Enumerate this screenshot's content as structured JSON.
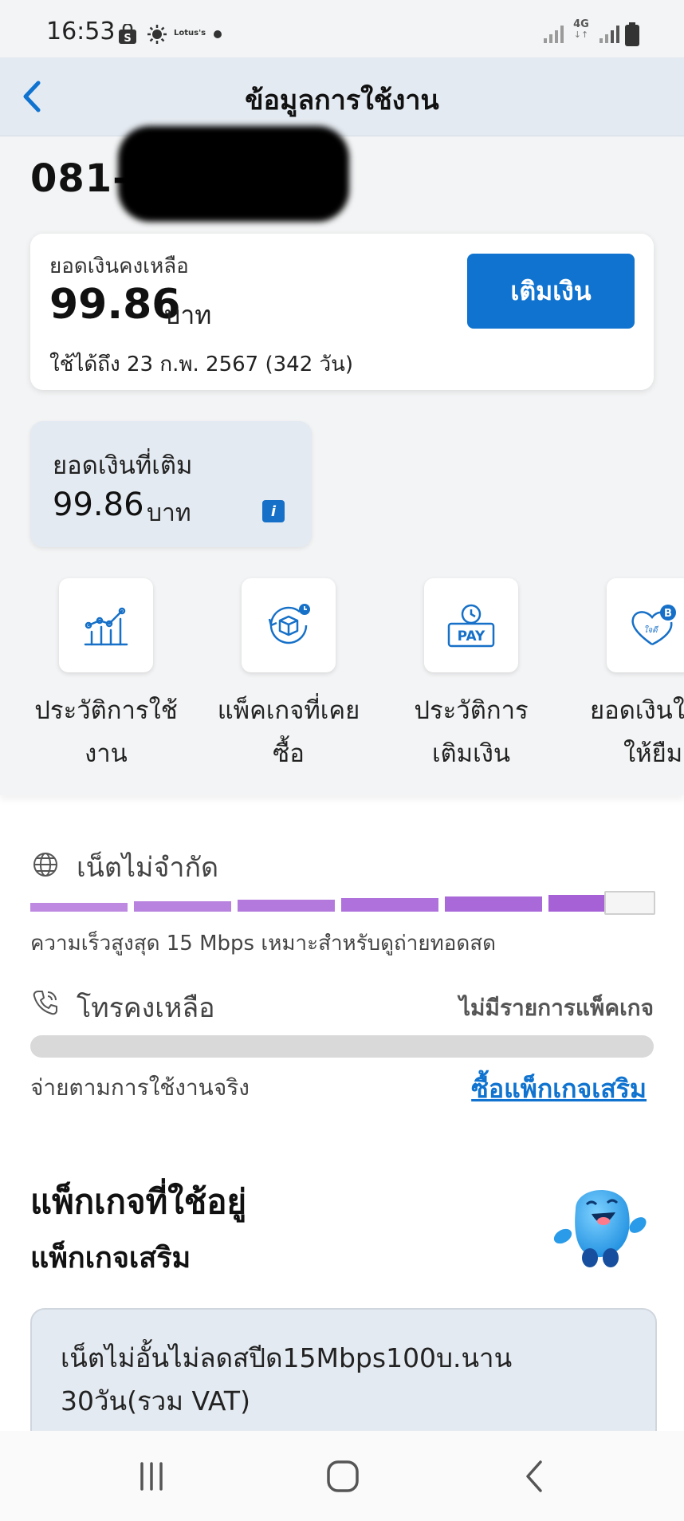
{
  "status_bar": {
    "time": "16:53",
    "network_type": "4G",
    "icons": [
      "shopping-bag-icon",
      "brightness-icon",
      "lotus-logo",
      "dot-icon",
      "signal-icon",
      "signal-4g-icon",
      "signal-icon",
      "battery-icon"
    ],
    "lotus_logo_text": "Lotus's"
  },
  "header": {
    "title": "ข้อมูลการใช้งาน",
    "back_icon": "chevron-left-icon"
  },
  "account": {
    "phone_number": "081-"
  },
  "balance": {
    "label": "ยอดเงินคงเหลือ",
    "amount": "99.86",
    "unit": "บาท",
    "expiry_prefix": "ใช้ได้ถึง",
    "expiry_value": "23 ก.พ. 2567 (342 วัน)",
    "topup_button": "เติมเงิน"
  },
  "topped_up": {
    "label": "ยอดเงินที่เติม",
    "amount": "99.86",
    "unit": "บาท",
    "info_icon": "info-icon"
  },
  "shortcuts": [
    {
      "label_line1": "ประวัติการใช้",
      "label_line2": "งาน",
      "icon": "usage-chart-icon"
    },
    {
      "label_line1": "แพ็คเกจที่เคย",
      "label_line2": "ซื้อ",
      "icon": "package-history-icon"
    },
    {
      "label_line1": "ประวัติการ",
      "label_line2": "เติมเงิน",
      "icon": "pay-history-icon"
    },
    {
      "label_line1": "ยอดเงินใ",
      "label_line2": "ให้ยืม",
      "icon": "heart-baht-icon",
      "badge_text": "ใจดี"
    }
  ],
  "internet": {
    "title": "เน็ตไม่จำกัด",
    "icon": "globe-icon",
    "segments_total": 7,
    "segments_filled": 6,
    "bar_color": "#a35cd6",
    "description": "ความเร็วสูงสุด 15 Mbps เหมาะสำหรับดูถ่ายทอดสด"
  },
  "calls": {
    "title": "โทรคงเหลือ",
    "icon": "phone-icon",
    "status": "ไม่มีรายการแพ็คเกจ",
    "pay_as_use": "จ่ายตามการใช้งานจริง",
    "buy_addon": "ซื้อแพ็กเกจเสริม"
  },
  "packages": {
    "title": "แพ็กเกจที่ใช้อยู่",
    "subtitle": "แพ็กเกจเสริม",
    "mascot": "mascot-image",
    "items": [
      {
        "name": "เน็ตไม่อั้นไม่ลดสปีด15Mbps100บ.นาน 30วัน(รวม VAT)"
      }
    ]
  },
  "nav_bar": {
    "icons": [
      "recent-apps-icon",
      "home-icon",
      "back-icon"
    ]
  },
  "colors": {
    "primary_blue": "#0f73cf",
    "card_blue_grey": "#e4eaf1",
    "purple": "#a35cd6"
  }
}
